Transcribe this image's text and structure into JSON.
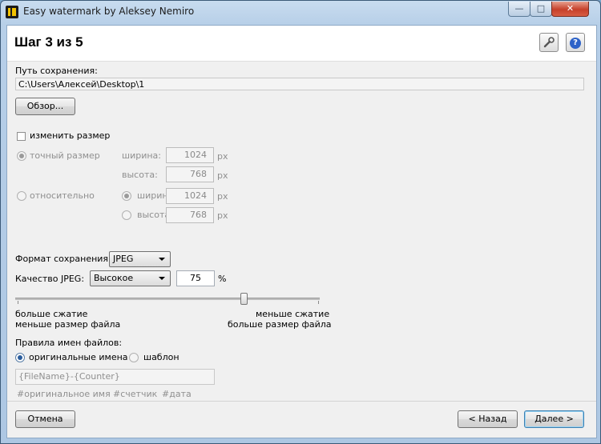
{
  "window": {
    "title": "Easy watermark by Aleksey Nemiro",
    "minimize": "—",
    "maximize": "□",
    "close": "✕"
  },
  "header": {
    "step": "Шаг 3 из 5"
  },
  "save": {
    "label": "Путь сохранения:",
    "path": "C:\\Users\\Алексей\\Desktop\\1",
    "browse": "Обзор..."
  },
  "resize": {
    "checkbox_label": "изменить размер",
    "exact_label": "точный размер",
    "relative_label": "относительно",
    "width_label": "ширина:",
    "height_label": "высота:",
    "exact_width": "1024",
    "exact_height": "768",
    "rel_width": "1024",
    "rel_height": "768",
    "unit": "px"
  },
  "format": {
    "label": "Формат сохранения:",
    "value": "JPEG"
  },
  "quality": {
    "label": "Качество JPEG:",
    "preset": "Высокое",
    "value": "75",
    "unit": "%",
    "left_line1": "больше сжатие",
    "left_line2": "меньше размер файла",
    "right_line1": "меньше сжатие",
    "right_line2": "больше размер файла",
    "slider_value": 0.75
  },
  "naming": {
    "label": "Правила имен файлов:",
    "option_original": "оригинальные имена",
    "option_template": "шаблон",
    "template_value": "{FileName}-{Counter}",
    "tag_original": "#оригинальное имя",
    "tag_counter": "#счетчик",
    "tag_date": "#дата"
  },
  "footer": {
    "cancel": "Отмена",
    "back": "< Назад",
    "next": "Далее >"
  }
}
